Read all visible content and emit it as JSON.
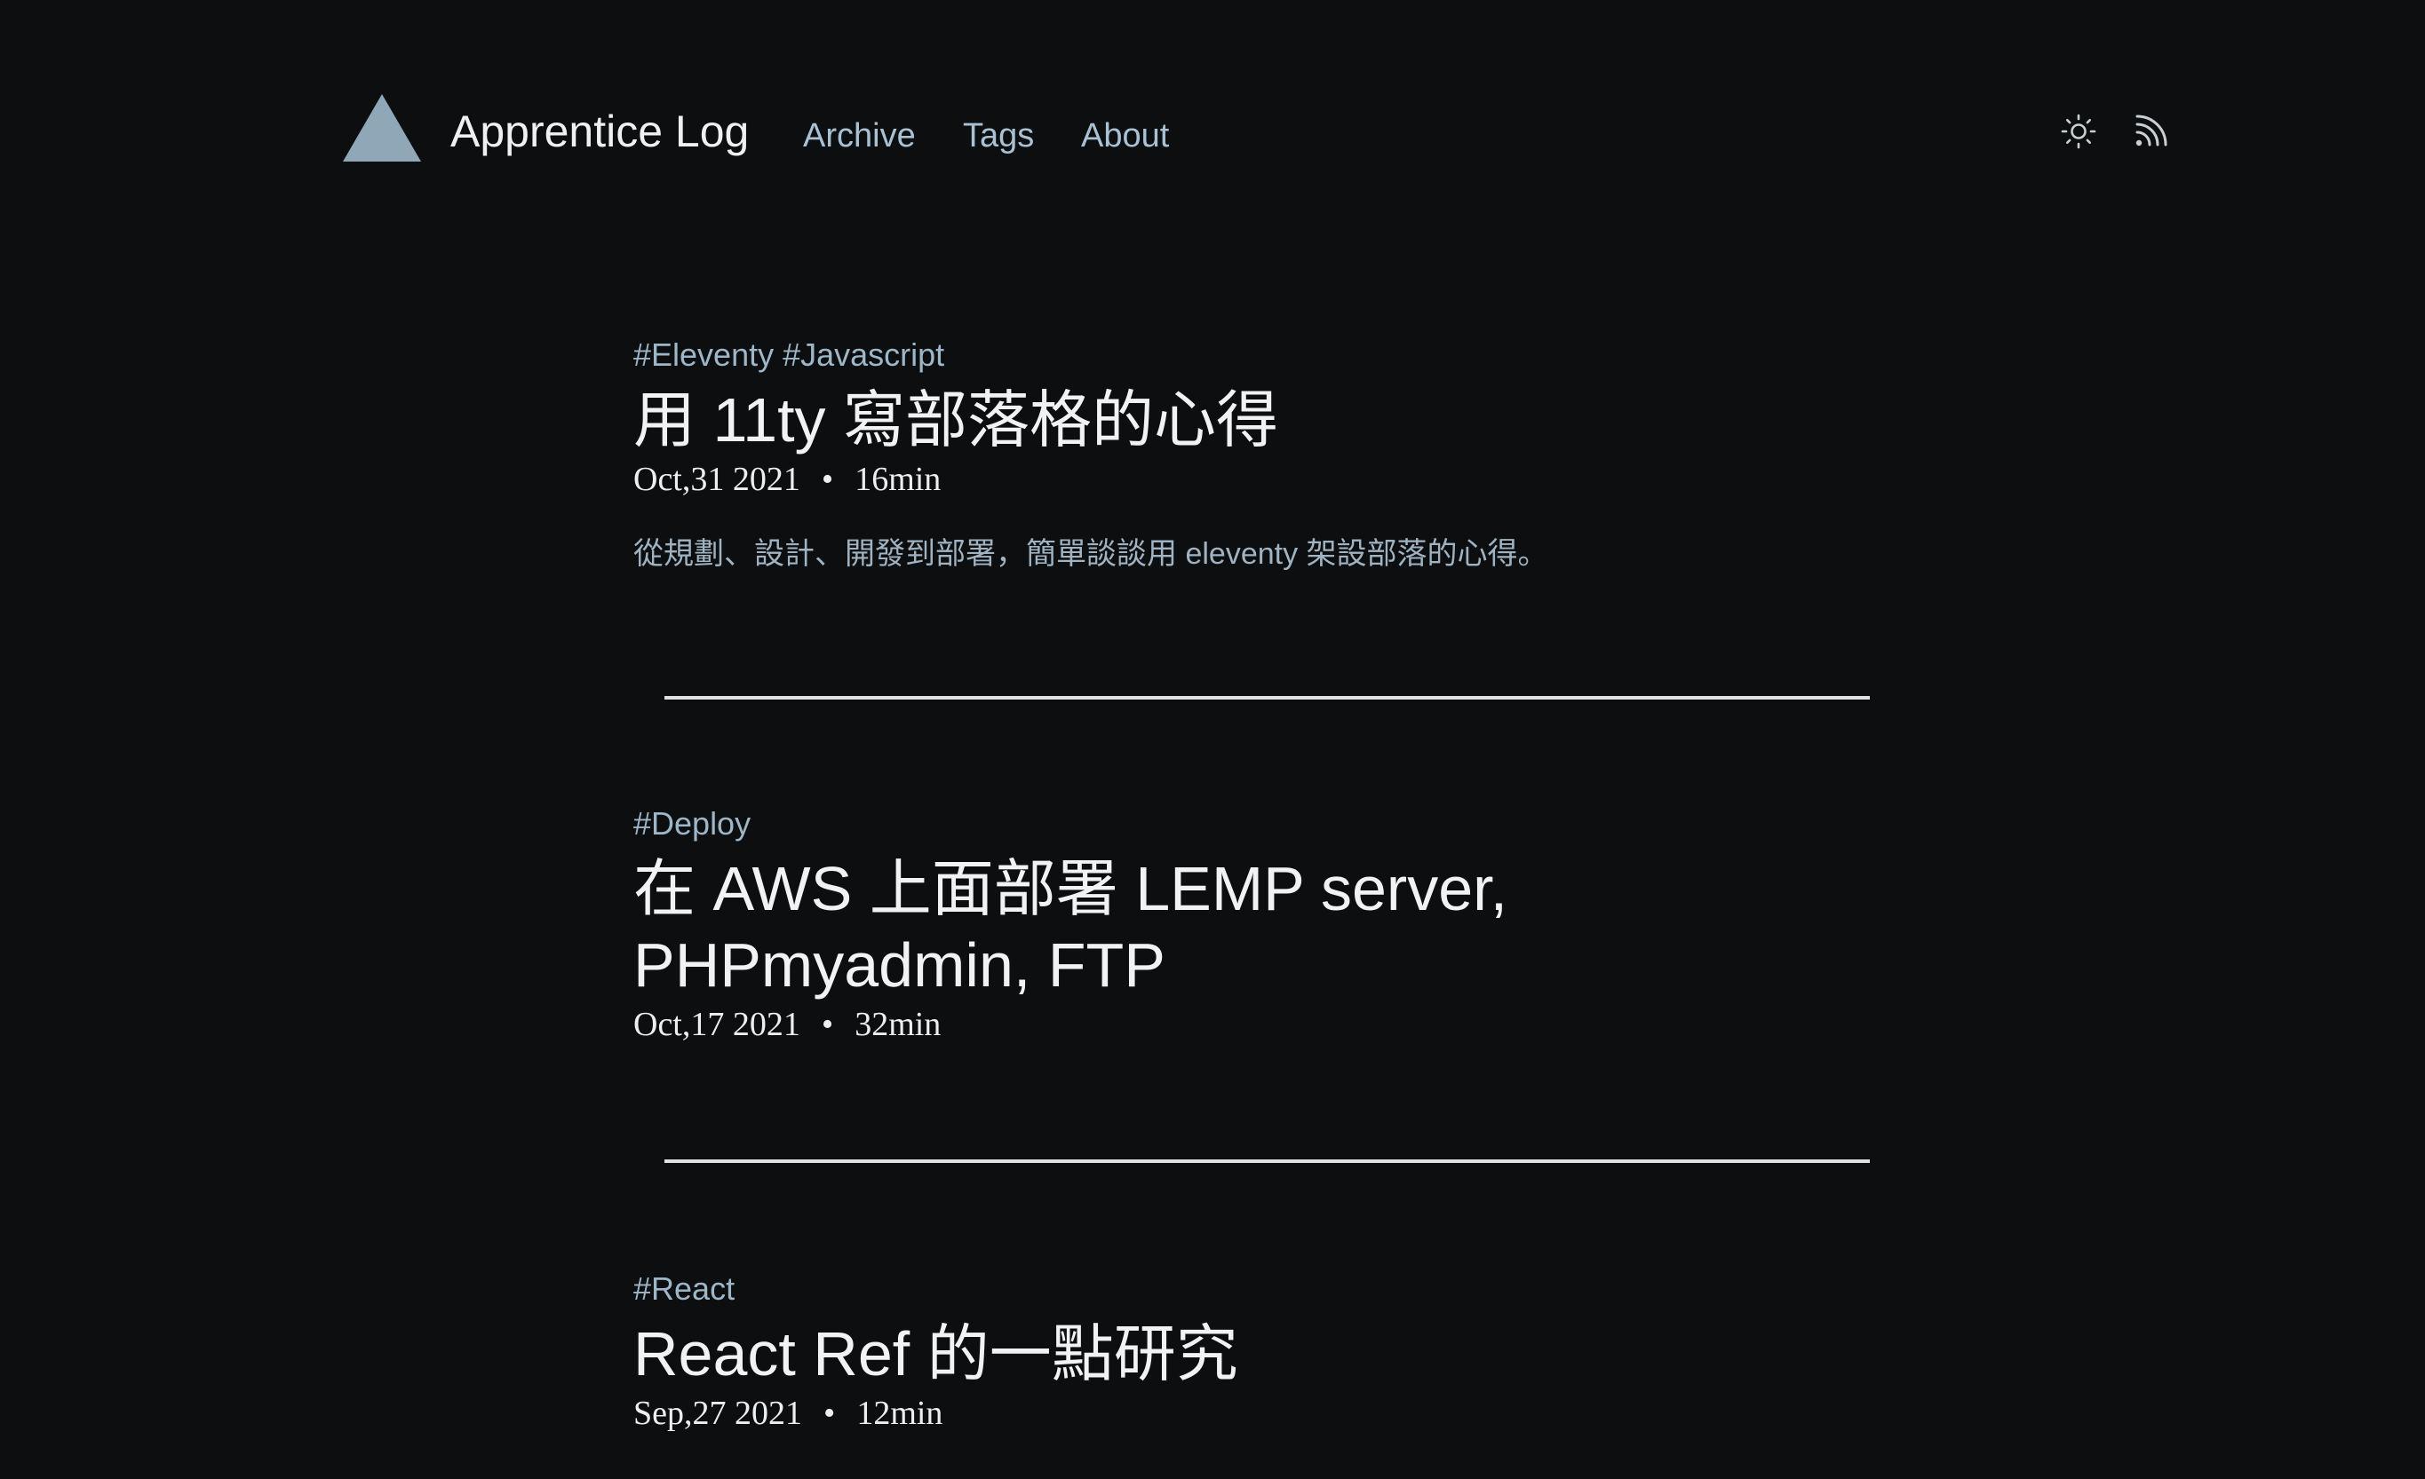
{
  "header": {
    "site_title": "Apprentice Log",
    "nav": [
      {
        "label": "Archive"
      },
      {
        "label": "Tags"
      },
      {
        "label": "About"
      }
    ],
    "logo_color": "#8fa7b7",
    "icons": [
      "sun-icon",
      "rss-icon"
    ]
  },
  "posts": [
    {
      "tags": [
        "#Eleventy",
        "#Javascript"
      ],
      "title": "用 11ty 寫部落格的心得",
      "date": "Oct,31 2021",
      "read_time": "16min",
      "excerpt": "從規劃、設計、開發到部署，簡單談談用 eleventy 架設部落的心得。"
    },
    {
      "tags": [
        "#Deploy"
      ],
      "title": "在 AWS 上面部署 LEMP server, PHPmyadmin, FTP",
      "date": "Oct,17 2021",
      "read_time": "32min"
    },
    {
      "tags": [
        "#React"
      ],
      "title": "React Ref 的一點研究",
      "date": "Sep,27 2021",
      "read_time": "12min"
    }
  ],
  "meta_separator": "•",
  "colors": {
    "background": "#0d0e10",
    "accent": "#a9c1d4",
    "text": "#eef0f2"
  }
}
